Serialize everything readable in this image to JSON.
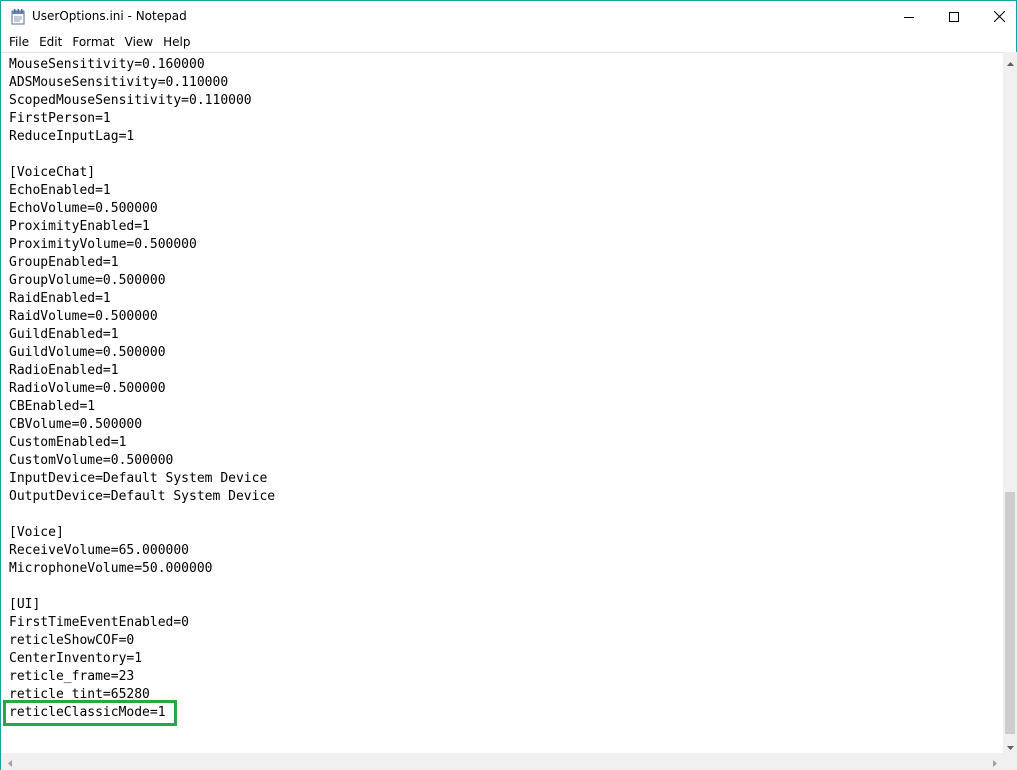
{
  "window": {
    "title": "UserOptions.ini - Notepad"
  },
  "menu": {
    "items": [
      "File",
      "Edit",
      "Format",
      "View",
      "Help"
    ]
  },
  "editor": {
    "lines": [
      "MouseSensitivity=0.160000",
      "ADSMouseSensitivity=0.110000",
      "ScopedMouseSensitivity=0.110000",
      "FirstPerson=1",
      "ReduceInputLag=1",
      "",
      "[VoiceChat]",
      "EchoEnabled=1",
      "EchoVolume=0.500000",
      "ProximityEnabled=1",
      "ProximityVolume=0.500000",
      "GroupEnabled=1",
      "GroupVolume=0.500000",
      "RaidEnabled=1",
      "RaidVolume=0.500000",
      "GuildEnabled=1",
      "GuildVolume=0.500000",
      "RadioEnabled=1",
      "RadioVolume=0.500000",
      "CBEnabled=1",
      "CBVolume=0.500000",
      "CustomEnabled=1",
      "CustomVolume=0.500000",
      "InputDevice=Default System Device",
      "OutputDevice=Default System Device",
      "",
      "[Voice]",
      "ReceiveVolume=65.000000",
      "MicrophoneVolume=50.000000",
      "",
      "[UI]",
      "FirstTimeEventEnabled=0",
      "reticleShowCOF=0",
      "CenterInventory=1",
      "reticle_frame=23",
      "reticle_tint=65280",
      "reticleClassicMode=1"
    ],
    "highlight_color": "#28a745"
  },
  "colors": {
    "window_border": "#18a3a0",
    "scrollbar_track": "#f0f0f0",
    "scrollbar_thumb": "#cdcdcd"
  },
  "icons": {
    "app": "notepad-icon",
    "minimize": "minimize-icon",
    "maximize": "maximize-icon",
    "close": "close-icon"
  }
}
